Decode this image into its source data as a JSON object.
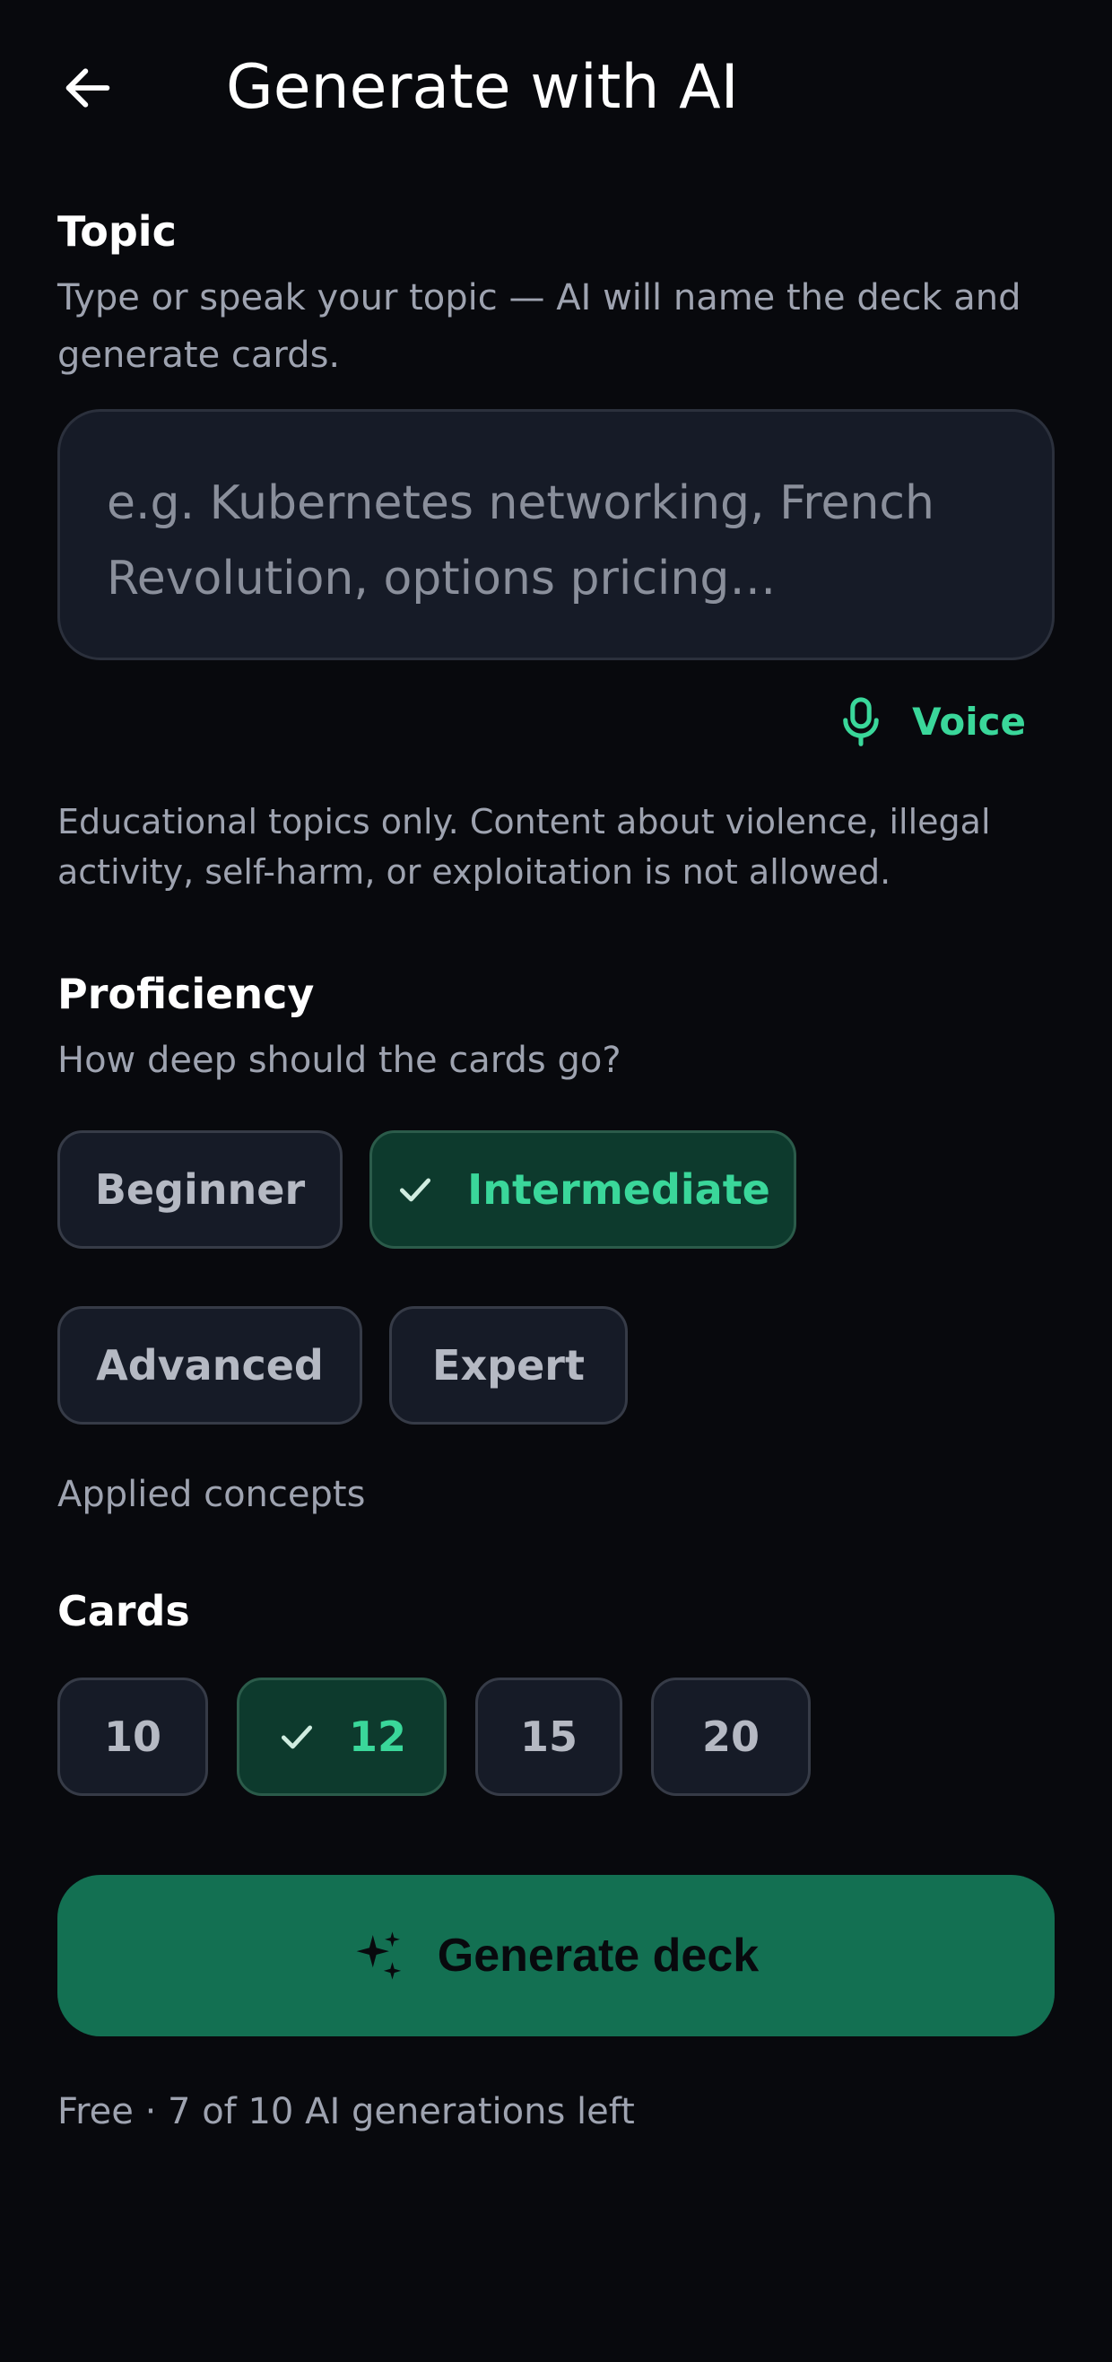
{
  "header": {
    "title": "Generate with AI",
    "back_icon": "arrow-left-icon"
  },
  "topic": {
    "title": "Topic",
    "description": "Type or speak your topic — AI will name the deck and generate cards.",
    "input_value": "",
    "input_placeholder": "e.g. Kubernetes networking, French Revolution, options pricing…",
    "voice_label": "Voice",
    "voice_icon": "microphone-icon",
    "note": "Educational topics only. Content about violence, illegal activity, self-harm, or exploitation is not allowed."
  },
  "proficiency": {
    "title": "Proficiency",
    "description": "How deep should the cards go?",
    "options": [
      {
        "label": "Beginner",
        "selected": false
      },
      {
        "label": "Intermediate",
        "selected": true
      },
      {
        "label": "Advanced",
        "selected": false
      },
      {
        "label": "Expert",
        "selected": false
      }
    ],
    "selected_description": "Applied concepts"
  },
  "cards": {
    "title": "Cards",
    "options": [
      {
        "label": "10",
        "selected": false
      },
      {
        "label": "12",
        "selected": true
      },
      {
        "label": "15",
        "selected": false
      },
      {
        "label": "20",
        "selected": false
      }
    ]
  },
  "generate": {
    "label": "Generate deck",
    "icon": "sparkles-icon"
  },
  "quota": {
    "text": "Free · 7 of 10 AI generations left"
  },
  "colors": {
    "background": "#08090d",
    "accent": "#3ad79a",
    "button": "#137052",
    "chip_bg": "#161b27",
    "chip_selected_bg": "#0d3a2d"
  }
}
